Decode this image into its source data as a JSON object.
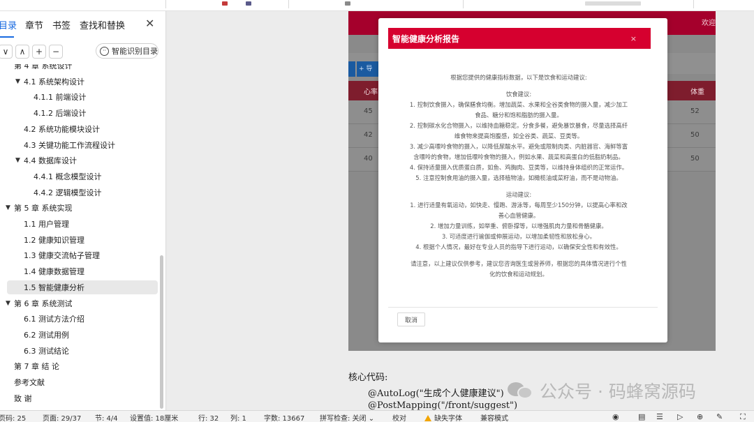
{
  "nav": {
    "tabs": [
      "目录",
      "章节",
      "书签",
      "查找和替换"
    ],
    "close_glyph": "✕",
    "tools": {
      "collapse": "∨",
      "expand": "∧",
      "add": "+",
      "remove": "−",
      "auto_toc": "智能识别目录"
    },
    "toc": [
      {
        "label": "第 4 章  系统设计",
        "caret": "",
        "level": 0
      },
      {
        "label": "4.1   系统架构设计",
        "caret": "▼",
        "level": 1
      },
      {
        "label": "4.1.1   前端设计",
        "caret": "",
        "level": 2
      },
      {
        "label": "4.1.2   后端设计",
        "caret": "",
        "level": 2
      },
      {
        "label": "4.2   系统功能模块设计",
        "caret": "",
        "level": 1
      },
      {
        "label": "4.3   关键功能工作流程设计",
        "caret": "",
        "level": 1
      },
      {
        "label": "4.4   数据库设计",
        "caret": "▼",
        "level": 1
      },
      {
        "label": "4.4.1   概念模型设计",
        "caret": "",
        "level": 2
      },
      {
        "label": "4.4.2   逻辑模型设计",
        "caret": "",
        "level": 2
      },
      {
        "label": "第 5 章  系统实现",
        "caret": "▼",
        "level": 0
      },
      {
        "label": "1.1  用户管理",
        "caret": "",
        "level": 1
      },
      {
        "label": "1.2  健康知识管理",
        "caret": "",
        "level": 1
      },
      {
        "label": "1.3  健康交流帖子管理",
        "caret": "",
        "level": 1
      },
      {
        "label": "1.4  健康数据管理",
        "caret": "",
        "level": 1
      },
      {
        "label": "1.5  智能健康分析",
        "caret": "",
        "level": 1,
        "selected": true
      },
      {
        "label": "第 6 章  系统测试",
        "caret": "▼",
        "level": 0
      },
      {
        "label": "6.1   测试方法介绍",
        "caret": "",
        "level": 1
      },
      {
        "label": "6.2   测试用例",
        "caret": "",
        "level": 1
      },
      {
        "label": "6.3   测试结论",
        "caret": "",
        "level": 1
      },
      {
        "label": "第 7 章   结      论",
        "caret": "",
        "level": 0
      },
      {
        "label": "参考文献",
        "caret": "",
        "level": 0
      },
      {
        "label": "致      谢",
        "caret": "",
        "level": 0
      }
    ]
  },
  "shot": {
    "welcome": "欢迎",
    "button": "+ 导",
    "headers": [
      "心率",
      "体重"
    ],
    "rows": [
      {
        "left": "45",
        "right": "52"
      },
      {
        "left": "42",
        "right": "50"
      },
      {
        "left": "40",
        "right": "50"
      }
    ]
  },
  "modal": {
    "title": "智能健康分析报告",
    "close": "×",
    "intro": "根据您提供的健康指标数据，以下是饮食和运动建议:",
    "diet_title": "饮食建议:",
    "diet": [
      "1. 控制饮食摄入，确保膳食均衡。增加蔬菜、水果和全谷类食物的摄入量，减少加工",
      "食品、糖分和饱和脂肪的摄入量。",
      "2. 控制碳水化合物摄入，以维持血糖稳定。分食多餐，避免暴饮暴食，尽量选择高纤",
      "维食物来提高饱腹感，如全谷类、蔬菜、豆类等。",
      "3. 减少高嘌呤食物的摄入，以降低尿酸水平。避免或限制肉类、内脏器官、海鲜等富",
      "含嘌呤的食物，增加低嘌呤食物的摄入，例如水果、蔬菜和高蛋白的低脂奶制品。",
      "4. 保持适量摄入优质蛋白质，如鱼、鸡胸肉、豆类等，以维持身体组织的正常运作。",
      "5. 注意控制食用油的摄入量，选择植物油，如橄榄油或菜籽油，而不是动物油。"
    ],
    "exercise_title": "运动建议:",
    "exercise": [
      "1. 进行适量有氧运动，如快走、慢跑、游泳等，每周至少150分钟，以提高心率和改",
      "善心血管健康。",
      "2. 增加力量训练，如举重、俯卧撑等，以增强肌肉力量和骨骼健康。",
      "3. 可适度进行瑜伽或伸展运动，以增加柔韧性和放松身心。",
      "4. 根据个人情况，最好在专业人员的指导下进行运动，以确保安全性和有效性。"
    ],
    "note": [
      "请注意，以上建议仅供参考，建议您咨询医生或营养师，根据您的具体情况进行个性",
      "化的饮食和运动规划。"
    ],
    "cancel": "取消"
  },
  "doc": {
    "heading": "核心代码:",
    "line1": "@AutoLog(\"生成个人健康建议\")",
    "line2": "@PostMapping(\"/front/suggest\")"
  },
  "watermark": "公众号 · 码蜂窝源码",
  "status": {
    "page_no": "页码: 25",
    "page": "页面: 29/37",
    "section": "节: 4/4",
    "setting": "设置值: 18厘米",
    "row": "行: 32",
    "col": "列: 1",
    "words": "字数: 13667",
    "spell": "拼写检查: 关闭",
    "spell_caret": "⌄",
    "proof": "校对",
    "missing_font": "缺失字体",
    "compat": "兼容模式"
  },
  "colors": {
    "accent_blue": "#1769e0",
    "modal_red": "#d6002f",
    "shot_header": "#a5002c",
    "warning": "#f2a500"
  }
}
